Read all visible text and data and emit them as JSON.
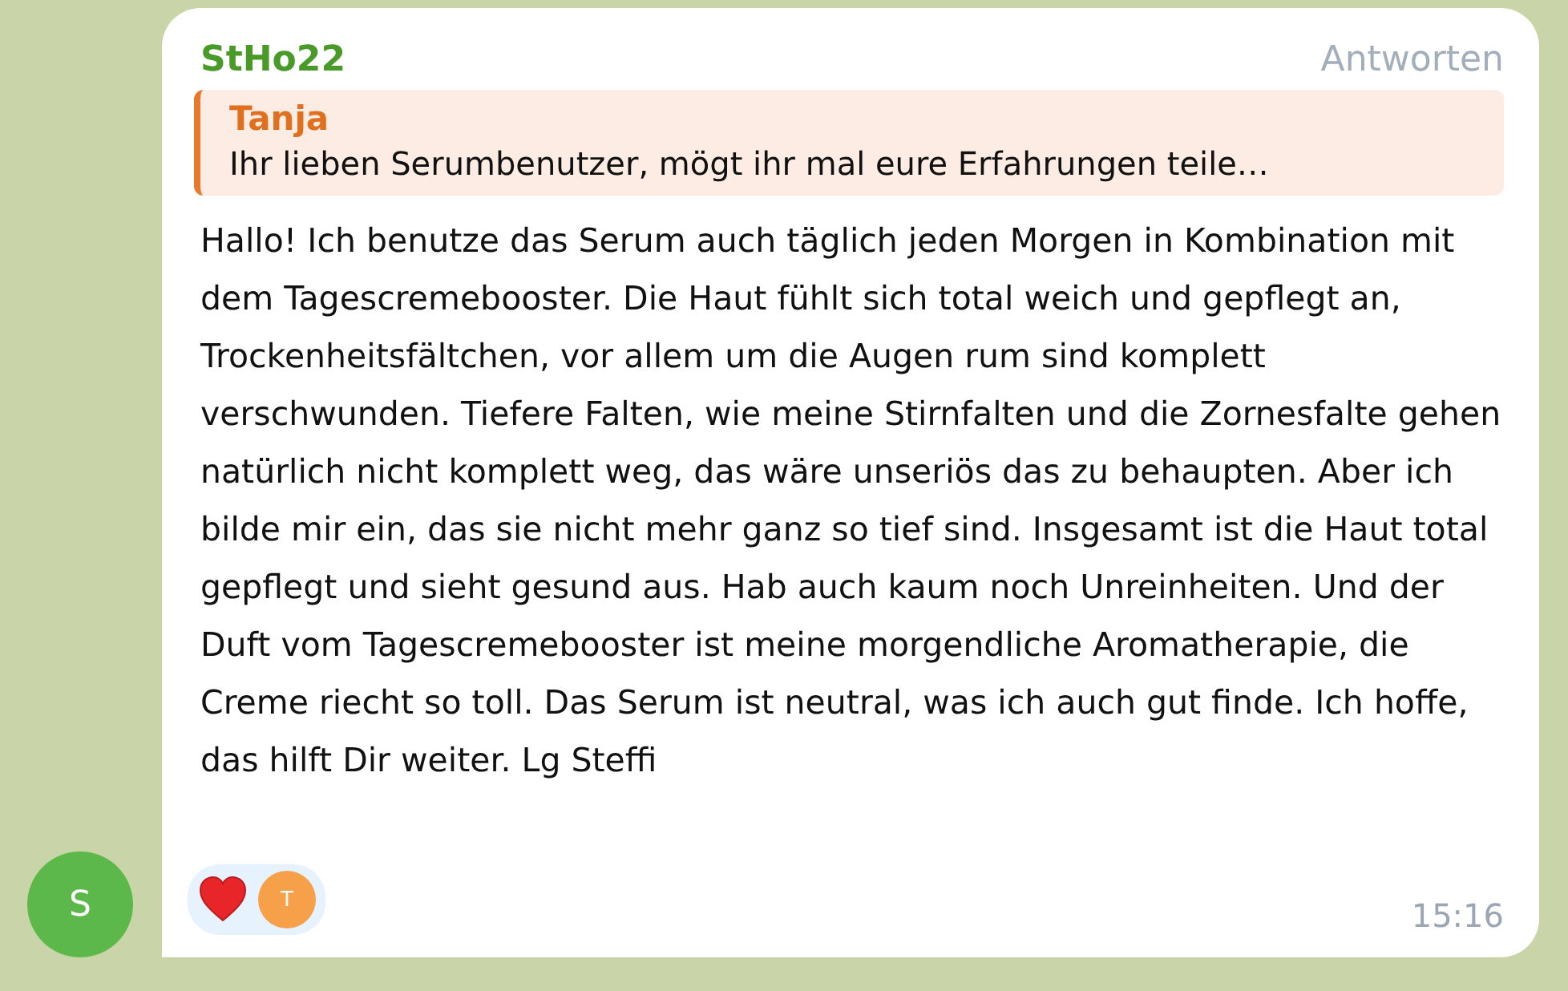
{
  "message": {
    "author": "StHo22",
    "reply_action": "Antworten",
    "quote": {
      "author": "Tanja",
      "text": "Ihr lieben Serumbenutzer, mögt ihr mal eure Erfahrungen teile…"
    },
    "text": "Hallo! Ich benutze das Serum auch täglich jeden Morgen in Kombination mit dem Tagescremebooster. Die Haut fühlt sich total weich und gepflegt an, Trockenheitsfältchen, vor allem um die Augen rum sind komplett verschwunden. Tiefere Falten, wie meine Stirnfalten und die Zornesfalte gehen natürlich nicht komplett weg, das wäre unseriös das zu behaupten. Aber ich bilde mir ein, das sie nicht mehr ganz so tief sind. Insgesamt ist die Haut total gepflegt und sieht gesund aus. Hab auch kaum noch Unreinheiten. Und der Duft vom Tagescremebooster ist meine morgendliche Aromatherapie, die Creme riecht so toll. Das Serum ist neutral, was ich auch gut finde. Ich hoffe, das hilft Dir weiter. Lg Steffi",
    "reactions": [
      {
        "kind": "heart",
        "users": [
          {
            "initial": "T",
            "color": "#f7a04a"
          }
        ]
      }
    ],
    "time": "15:16",
    "sender_avatar": {
      "initial": "S",
      "color": "#5cb84a"
    }
  }
}
